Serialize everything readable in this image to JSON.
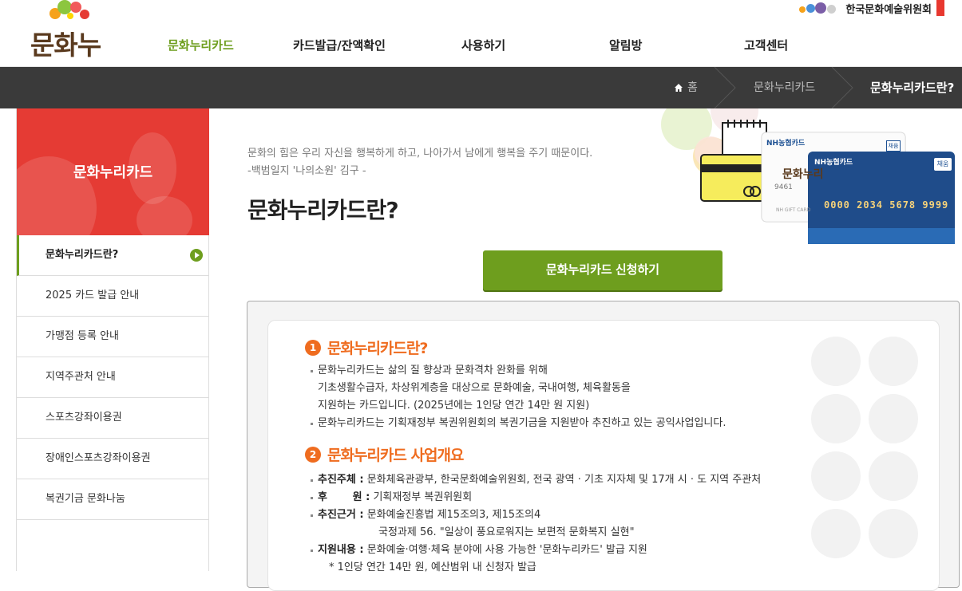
{
  "logo": {
    "text": "문화누리"
  },
  "org": {
    "name": "한국문화예술위원회"
  },
  "gnb": [
    "문화누리카드",
    "카드발급/잔액확인",
    "사용하기",
    "알림방",
    "고객센터"
  ],
  "breadcrumb": {
    "home": "홈",
    "section": "문화누리카드",
    "current": "문화누리카드란?"
  },
  "sidebar": {
    "title": "문화누리카드",
    "items": [
      "문화누리카드란?",
      "2025 카드 발급 안내",
      "가맹점 등록 안내",
      "지역주관처 안내",
      "스포츠강좌이용권",
      "장애인스포츠강좌이용권",
      "복권기금 문화나눔"
    ]
  },
  "quote": {
    "line1": "문화의 힘은 우리 자신을 행복하게 하고, 나아가서 남에게 행복을 주기 때문이다.",
    "line2": "-백범일지 '나의소원' 김구 -"
  },
  "page_title": "문화누리카드란?",
  "cards": {
    "brand": "NH농협카드",
    "badge": "채움",
    "number": "0000 2034 5678 9999",
    "small_card_number": "9461",
    "gift": "NH GIFT CARD"
  },
  "apply_button": "문화누리카드 신청하기",
  "section1": {
    "num": "1",
    "title": "문화누리카드란?",
    "lines": [
      "문화누리카드는 삶의 질 향상과 문화격차 완화를 위해",
      "기초생활수급자, 차상위계층을 대상으로 문화예술, 국내여행, 체육활동을",
      "지원하는 카드입니다. (2025년에는 1인당 연간 14만 원 지원)",
      "문화누리카드는 기획재정부 복권위원회의 복권기금을 지원받아 추진하고 있는 공익사업입니다."
    ]
  },
  "section2": {
    "num": "2",
    "title": "문화누리카드 사업개요",
    "rows": [
      {
        "label": "추진주체 :",
        "text": "문화체육관광부, 한국문화예술위원회, 전국 광역 · 기초 지자체 및 17개 시 · 도 지역 주관처"
      },
      {
        "label": "후       원 :",
        "text": "기획재정부 복권위원회"
      },
      {
        "label": "추진근거 :",
        "text": "문화예술진흥법 제15조의3, 제15조의4"
      },
      {
        "label": "",
        "text": "국정과제 56. \"일상이 풍요로워지는 보편적 문화복지 실현\""
      },
      {
        "label": "지원내용 :",
        "text": "문화예술·여행·체육 분야에 사용 가능한 '문화누리카드' 발급 지원"
      },
      {
        "label": "",
        "text": "* 1인당 연간 14만 원, 예산범위 내 신청자 발급"
      }
    ]
  },
  "colors": {
    "brand_green": "#6e9e1e",
    "accent_orange": "#ef6c1f",
    "sidebar_red": "#e53b34",
    "bar_dark": "#3a3a3a"
  }
}
